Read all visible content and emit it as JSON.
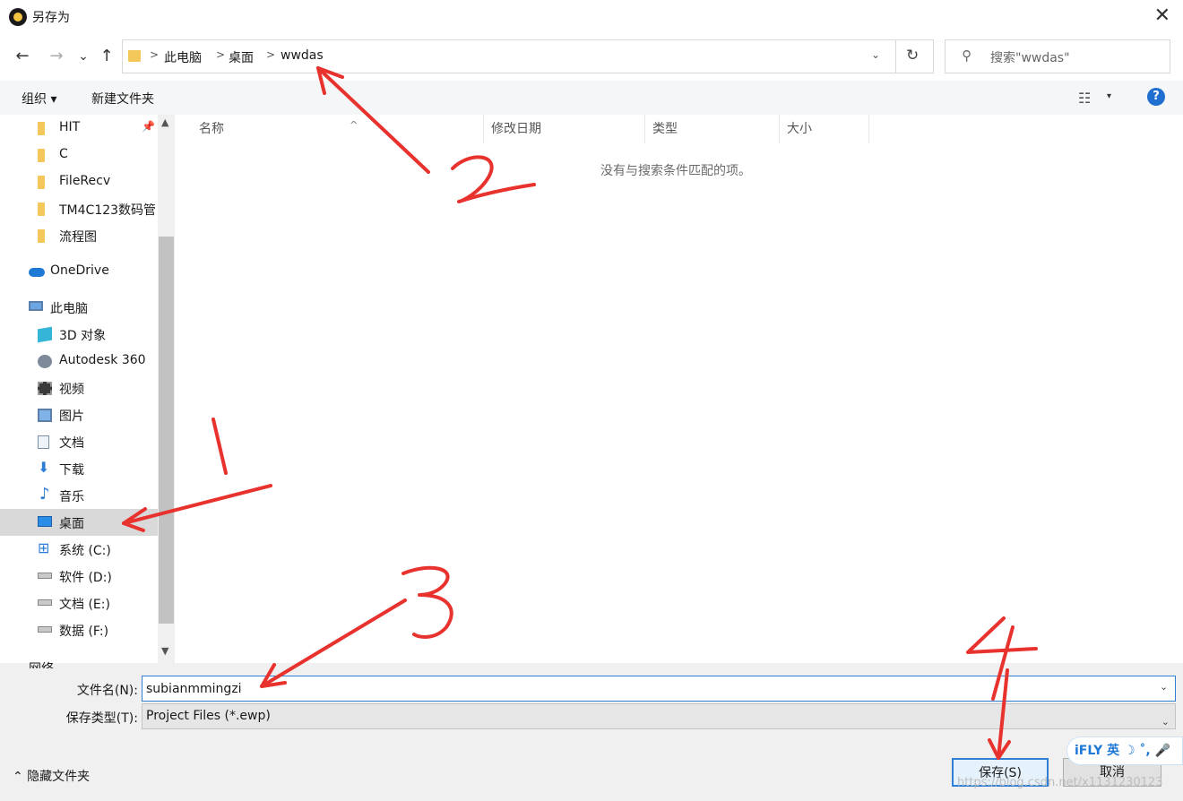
{
  "window": {
    "title": "另存为",
    "close_glyph": "✕"
  },
  "nav": {
    "back_glyph": "←",
    "forward_glyph": "→",
    "recent_glyph": "⌄",
    "up_glyph": "↑"
  },
  "address": {
    "breadcrumbs": [
      "此电脑",
      "桌面",
      "wwdas"
    ],
    "separator_glyph": ">",
    "dropdown_glyph": "⌄",
    "refresh_glyph": "↻"
  },
  "search": {
    "placeholder": "搜索\"wwdas\"",
    "icon_glyph": "⚲"
  },
  "toolbar": {
    "organize_label": "组织 ▾",
    "new_folder_label": "新建文件夹",
    "view_glyph": "☷",
    "view_caret": "▾",
    "help_glyph": "?"
  },
  "sidebar": {
    "items": [
      {
        "label": "HIT",
        "icon": "folder-icon",
        "pinned": true
      },
      {
        "label": "C",
        "icon": "folder-icon"
      },
      {
        "label": "FileRecv",
        "icon": "folder-icon"
      },
      {
        "label": "TM4C123数码管",
        "icon": "folder-icon"
      },
      {
        "label": "流程图",
        "icon": "folder-icon"
      },
      {
        "label": "OneDrive",
        "icon": "onedrive-icon"
      },
      {
        "label": "此电脑",
        "icon": "this-pc-icon"
      },
      {
        "label": "3D 对象",
        "icon": "3d-objects-icon"
      },
      {
        "label": "Autodesk 360",
        "icon": "autodesk-icon"
      },
      {
        "label": "视频",
        "icon": "video-icon"
      },
      {
        "label": "图片",
        "icon": "picture-icon"
      },
      {
        "label": "文档",
        "icon": "document-icon"
      },
      {
        "label": "下载",
        "icon": "download-icon"
      },
      {
        "label": "音乐",
        "icon": "music-icon"
      },
      {
        "label": "桌面",
        "icon": "desktop-icon",
        "selected": true
      },
      {
        "label": "系统 (C:)",
        "icon": "system-drive-icon"
      },
      {
        "label": "软件 (D:)",
        "icon": "drive-icon"
      },
      {
        "label": "文档 (E:)",
        "icon": "drive-icon"
      },
      {
        "label": "数据 (F:)",
        "icon": "drive-icon"
      }
    ],
    "partial_item": "网络",
    "pin_glyph": "📌",
    "scroll_up_glyph": "▲",
    "scroll_down_glyph": "▼"
  },
  "file_list": {
    "columns": [
      "名称",
      "修改日期",
      "类型",
      "大小"
    ],
    "sort_glyph": "^",
    "empty_message": "没有与搜索条件匹配的项。"
  },
  "save_form": {
    "filename_label": "文件名(N):",
    "filename_value": "subianmmingzi",
    "filetype_label": "保存类型(T):",
    "filetype_value": "Project Files (*.ewp)",
    "dropdown_glyph": "⌄",
    "hide_folders_label": "⌃  隐藏文件夹",
    "save_label": "保存(S)",
    "cancel_label": "取消"
  },
  "overlay": {
    "ime_badge": "iFLY 英 ☽ ˚, 🎤",
    "watermark": "https://blog.csdn.net/x1131230123",
    "annotation_color": "#e8322e",
    "annotations": [
      "1",
      "2",
      "3",
      "4"
    ]
  }
}
